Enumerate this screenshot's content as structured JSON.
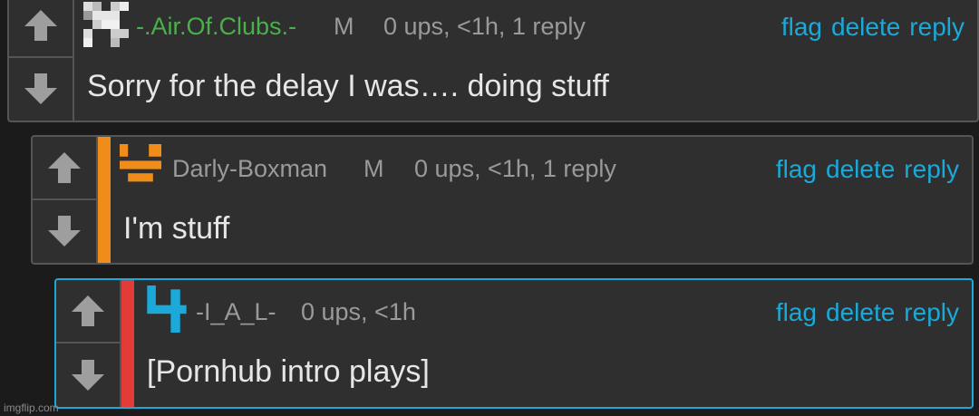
{
  "comments": [
    {
      "username": "-.Air.Of.Clubs.-",
      "username_color": "#49b04a",
      "mod_badge": "M",
      "meta": "0 ups, <1h, 1 reply",
      "body": "Sorry for the delay I was…. doing stuff",
      "actions": {
        "flag": "flag",
        "delete": "delete",
        "reply": "reply"
      }
    },
    {
      "username": "Darly-Boxman",
      "username_color": "#9a9a9a",
      "mod_badge": "M",
      "meta": "0 ups, <1h, 1 reply",
      "body": "I'm stuff",
      "accent_color": "#f08c1a",
      "actions": {
        "flag": "flag",
        "delete": "delete",
        "reply": "reply"
      }
    },
    {
      "username": "-I_A_L-",
      "username_color": "#9a9a9a",
      "meta": "0 ups, <1h",
      "body": "[Pornhub intro plays]",
      "accent_color": "#e33b36",
      "actions": {
        "flag": "flag",
        "delete": "delete",
        "reply": "reply"
      }
    }
  ],
  "colors": {
    "link": "#1aa9d8",
    "vote_arrow": "#9e9e9e",
    "selected_border": "#1aa9d8"
  },
  "watermark": "imgflip.com"
}
